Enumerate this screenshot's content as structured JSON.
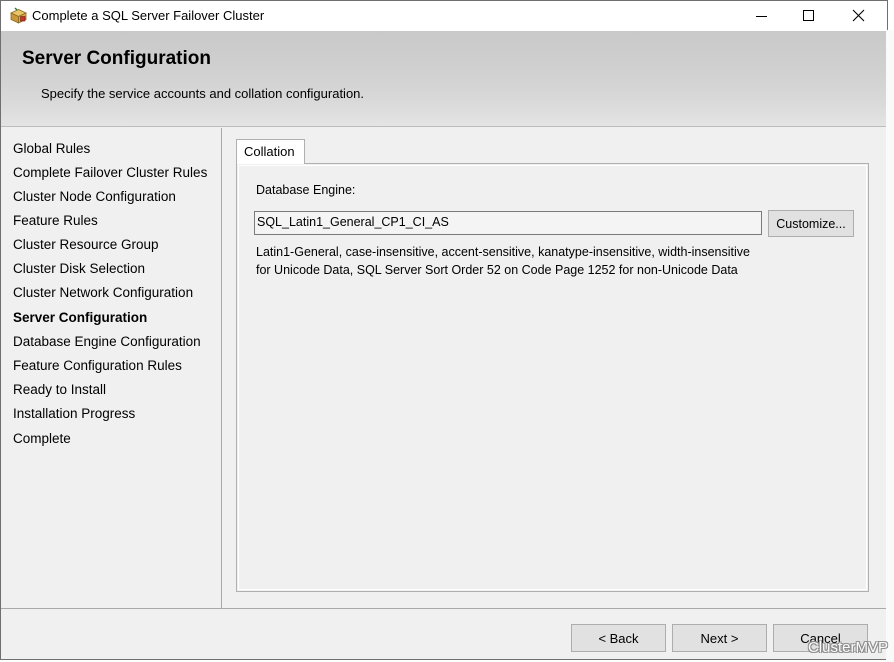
{
  "window": {
    "title": "Complete a SQL Server Failover Cluster",
    "icon": "setup-box-icon"
  },
  "header": {
    "title": "Server Configuration",
    "subtitle": "Specify the service accounts and collation configuration."
  },
  "sidebar": {
    "items": [
      {
        "label": "Global Rules",
        "active": false
      },
      {
        "label": "Complete Failover Cluster Rules",
        "active": false
      },
      {
        "label": "Cluster Node Configuration",
        "active": false
      },
      {
        "label": "Feature Rules",
        "active": false
      },
      {
        "label": "Cluster Resource Group",
        "active": false
      },
      {
        "label": "Cluster Disk Selection",
        "active": false
      },
      {
        "label": "Cluster Network Configuration",
        "active": false
      },
      {
        "label": "Server Configuration",
        "active": true
      },
      {
        "label": "Database Engine Configuration",
        "active": false
      },
      {
        "label": "Feature Configuration Rules",
        "active": false
      },
      {
        "label": "Ready to Install",
        "active": false
      },
      {
        "label": "Installation Progress",
        "active": false
      },
      {
        "label": "Complete",
        "active": false
      }
    ]
  },
  "main": {
    "tabs": [
      {
        "label": "Collation",
        "selected": true
      }
    ],
    "db_engine_label": "Database Engine:",
    "collation_value": "SQL_Latin1_General_CP1_CI_AS",
    "customize_label": "Customize...",
    "description": "Latin1-General, case-insensitive, accent-sensitive, kanatype-insensitive, width-insensitive for Unicode Data, SQL Server Sort Order 52 on Code Page 1252 for non-Unicode Data"
  },
  "footer": {
    "back_label": "< Back",
    "next_label": "Next >",
    "cancel_label": "Cancel"
  },
  "watermark": "ClusterMVP"
}
